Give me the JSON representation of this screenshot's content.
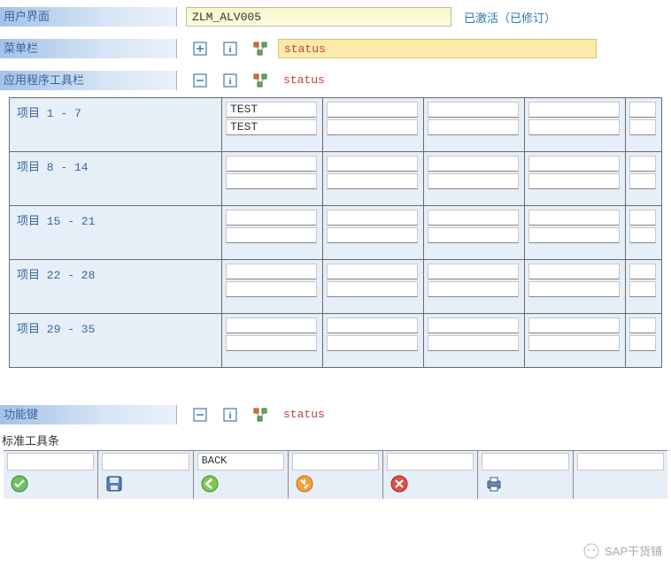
{
  "header": {
    "ui_label": "用户界面",
    "ui_value": "ZLM_ALV005",
    "status": "已激活（已修订）"
  },
  "menubar": {
    "label": "菜单栏",
    "status": "status"
  },
  "apptoolbar": {
    "label": "应用程序工具栏",
    "status": "status"
  },
  "funckeys": {
    "label": "功能键",
    "status": "status"
  },
  "grid": {
    "rows": [
      {
        "label": "项目  1 -  7",
        "cell0a": "TEST",
        "cell0b": "TEST"
      },
      {
        "label": "项目  8 - 14"
      },
      {
        "label": "项目 15 - 21"
      },
      {
        "label": "项目 22 - 28"
      },
      {
        "label": "项目 29 - 35"
      }
    ]
  },
  "stdtoolbar": {
    "label": "标准工具条",
    "items": [
      {
        "top": "",
        "icon": "ok"
      },
      {
        "top": "",
        "icon": "save"
      },
      {
        "top": "BACK",
        "icon": "back"
      },
      {
        "top": "",
        "icon": "exit"
      },
      {
        "top": "",
        "icon": "cancel"
      },
      {
        "top": "",
        "icon": "print"
      },
      {
        "top": "",
        "icon": "blank"
      }
    ]
  },
  "watermark": "SAP干货铺"
}
